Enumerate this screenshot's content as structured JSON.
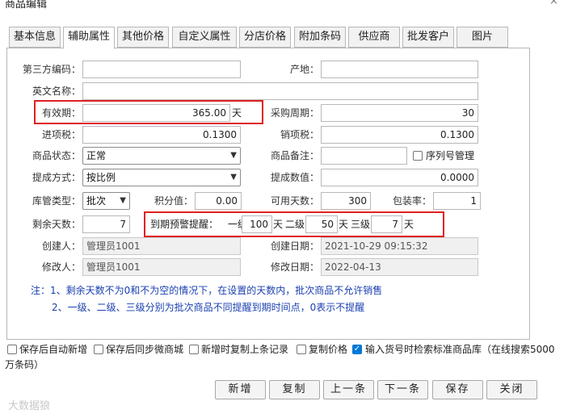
{
  "window": {
    "title": "商品编辑",
    "close_glyph": "×"
  },
  "tabs": [
    "基本信息",
    "辅助属性",
    "其他价格",
    "自定义属性",
    "分店价格",
    "附加条码",
    "供应商",
    "批发客户",
    "图片"
  ],
  "form": {
    "third_code": {
      "label": "第三方编码：",
      "value": ""
    },
    "origin": {
      "label": "产地：",
      "value": ""
    },
    "english_name": {
      "label": "英文名称：",
      "value": ""
    },
    "validity": {
      "label": "有效期：",
      "value": "365.00",
      "unit": "天"
    },
    "purchase_cycle": {
      "label": "采购周期：",
      "value": "30"
    },
    "input_tax": {
      "label": "进项税：",
      "value": "0.1300"
    },
    "output_tax": {
      "label": "销项税：",
      "value": "0.1300"
    },
    "status": {
      "label": "商品状态：",
      "value": "正常"
    },
    "remark": {
      "label": "商品备注：",
      "value": ""
    },
    "serial_mgmt": {
      "label": "序列号管理",
      "checked": false
    },
    "commission_method": {
      "label": "提成方式：",
      "value": "按比例"
    },
    "commission_value": {
      "label": "提成数值：",
      "value": "0.0000"
    },
    "stock_type": {
      "label": "库管类型：",
      "value": "批次"
    },
    "points": {
      "label": "积分值：",
      "value": "0.00"
    },
    "usable_days": {
      "label": "可用天数：",
      "value": "300"
    },
    "pack_rate": {
      "label": "包装率：",
      "value": "1"
    },
    "remaining_days": {
      "label": "剩余天数：",
      "value": "7"
    },
    "expiry_alert": {
      "label": "到期预警提醒：",
      "level1_label": "一级",
      "level1": "100",
      "level1_unit": "天",
      "level2_label": "二级",
      "level2": "50",
      "level2_unit": "天",
      "level3_label": "三级",
      "level3": "7",
      "level3_unit": "天"
    },
    "creator": {
      "label": "创建人：",
      "value": "管理员1001"
    },
    "created_date": {
      "label": "创建日期：",
      "value": "2021-10-29 09:15:32"
    },
    "modifier": {
      "label": "修改人：",
      "value": "管理员1001"
    },
    "modified_date": {
      "label": "修改日期：",
      "value": "2022-04-13"
    }
  },
  "notes": {
    "line1": "注：1、剩余天数不为0和不为空的情况下，在设置的天数内，批次商品不允许销售",
    "line2": "2、一级、二级、三级分别为批次商品不同提醒到期时间点，0表示不提醒"
  },
  "options": {
    "auto_new": {
      "label": "保存后自动新增",
      "checked": false
    },
    "sync_mall": {
      "label": "保存后同步微商城",
      "checked": false
    },
    "copy_last": {
      "label": "新增时复制上条记录",
      "checked": false
    },
    "copy_price": {
      "label": "复制价格",
      "checked": false
    },
    "barcode_search": {
      "label": "输入货号时检索标准商品库（在线搜索5000",
      "label_cont": "万条码）",
      "checked": true
    }
  },
  "buttons": {
    "new": "新增",
    "copy": "复制",
    "prev": "上一条",
    "next": "下一条",
    "save": "保存",
    "close": "关闭"
  },
  "watermark": "大数据狼",
  "colors": {
    "highlight": "#e02020",
    "note_text": "#1a3fb0",
    "checkbox_checked": "#0078d7"
  }
}
